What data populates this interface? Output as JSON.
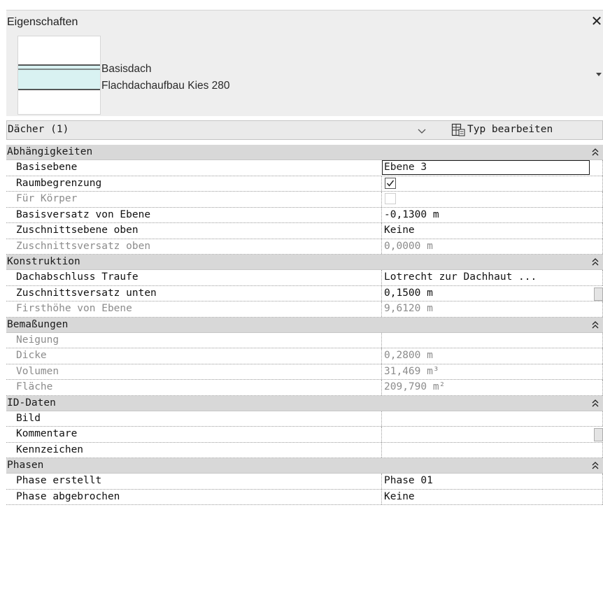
{
  "panel": {
    "title": "Eigenschaften",
    "close_glyph": "✕"
  },
  "type_selector": {
    "family": "Basisdach",
    "type": "Flachdachaufbau Kies 280",
    "preview_icon": "flat-roof-preview-icon"
  },
  "category": {
    "label": "Dächer (1)",
    "edit_type_label": "Typ bearbeiten"
  },
  "groups": [
    {
      "label": "Abhängigkeiten",
      "rows": [
        {
          "key": "Basisebene",
          "value": "Ebene 3"
        },
        {
          "key": "Raumbegrenzung",
          "value": "checked"
        },
        {
          "key": "Für Körper",
          "value": "unchecked"
        },
        {
          "key": "Basisversatz von Ebene",
          "value": "-0,1300 m"
        },
        {
          "key": "Zuschnittsebene oben",
          "value": "Keine"
        },
        {
          "key": "Zuschnittsversatz oben",
          "value": "0,0000 m"
        }
      ]
    },
    {
      "label": "Konstruktion",
      "rows": [
        {
          "key": "Dachabschluss Traufe",
          "value": "Lotrecht zur Dachhaut ..."
        },
        {
          "key": "Zuschnittsversatz unten",
          "value": "0,1500 m"
        },
        {
          "key": "Firsthöhe von Ebene",
          "value": "9,6120 m"
        }
      ]
    },
    {
      "label": "Bemaßungen",
      "rows": [
        {
          "key": "Neigung",
          "value": ""
        },
        {
          "key": "Dicke",
          "value": "0,2800 m"
        },
        {
          "key": "Volumen",
          "value": "31,469 m³"
        },
        {
          "key": "Fläche",
          "value": "209,790 m²"
        }
      ]
    },
    {
      "label": "ID-Daten",
      "rows": [
        {
          "key": "Bild",
          "value": ""
        },
        {
          "key": "Kommentare",
          "value": ""
        },
        {
          "key": "Kennzeichen",
          "value": ""
        }
      ]
    },
    {
      "label": "Phasen",
      "rows": [
        {
          "key": "Phase erstellt",
          "value": "Phase 01"
        },
        {
          "key": "Phase abgebrochen",
          "value": "Keine"
        }
      ]
    }
  ],
  "colors": {
    "header_bg": "#eeeeee",
    "group_bg": "#d8d8d8",
    "dim_text": "#8c8c8c",
    "preview_fill": "#d9f2f2"
  }
}
